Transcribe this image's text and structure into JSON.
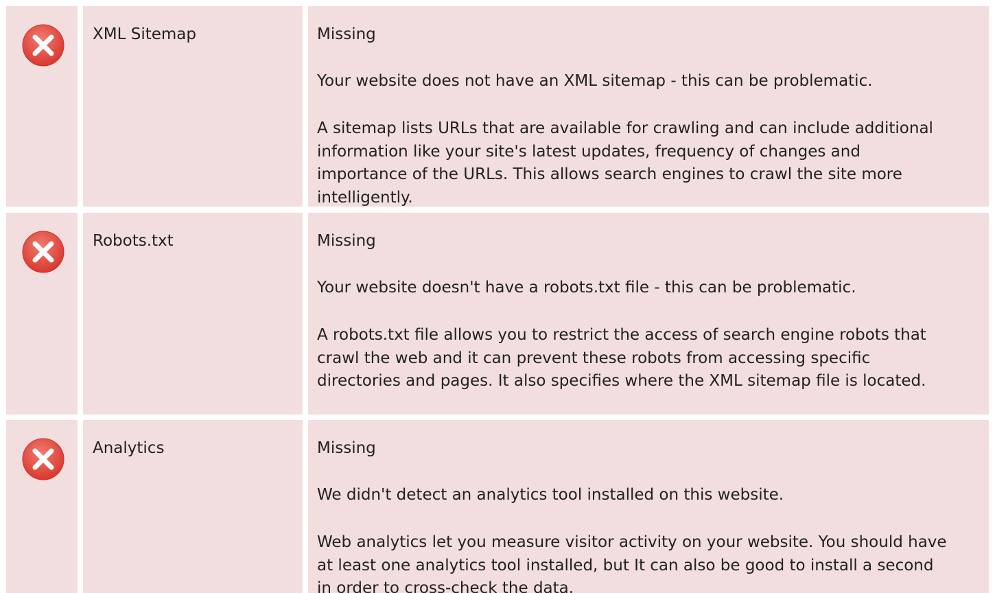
{
  "checks": [
    {
      "name": "XML Sitemap",
      "status": "Missing",
      "summary": "Your website does not have an XML sitemap - this can be problematic.",
      "detail": "A sitemap lists URLs that are available for crawling and can include additional information like your site's latest updates, frequency of changes and importance of the URLs. This allows search engines to crawl the site more intelligently.",
      "icon": "error-x-icon"
    },
    {
      "name": "Robots.txt",
      "status": "Missing",
      "summary": "Your website doesn't have a robots.txt file - this can be problematic.",
      "detail": "A robots.txt file allows you to restrict the access of search engine robots that crawl the web and it can prevent these robots from accessing specific directories and pages. It also specifies where the XML sitemap file is located.",
      "icon": "error-x-icon"
    },
    {
      "name": "Analytics",
      "status": "Missing",
      "summary": "We didn't detect an analytics tool installed on this website.",
      "detail": "Web analytics let you measure visitor activity on your website. You should have at least one analytics tool installed, but It can also be good to install a second in order to cross-check the data.",
      "icon": "error-x-icon"
    }
  ],
  "colors": {
    "row_background": "#f2dede",
    "icon_red": "#e0463c",
    "icon_cross": "#ffffff"
  }
}
